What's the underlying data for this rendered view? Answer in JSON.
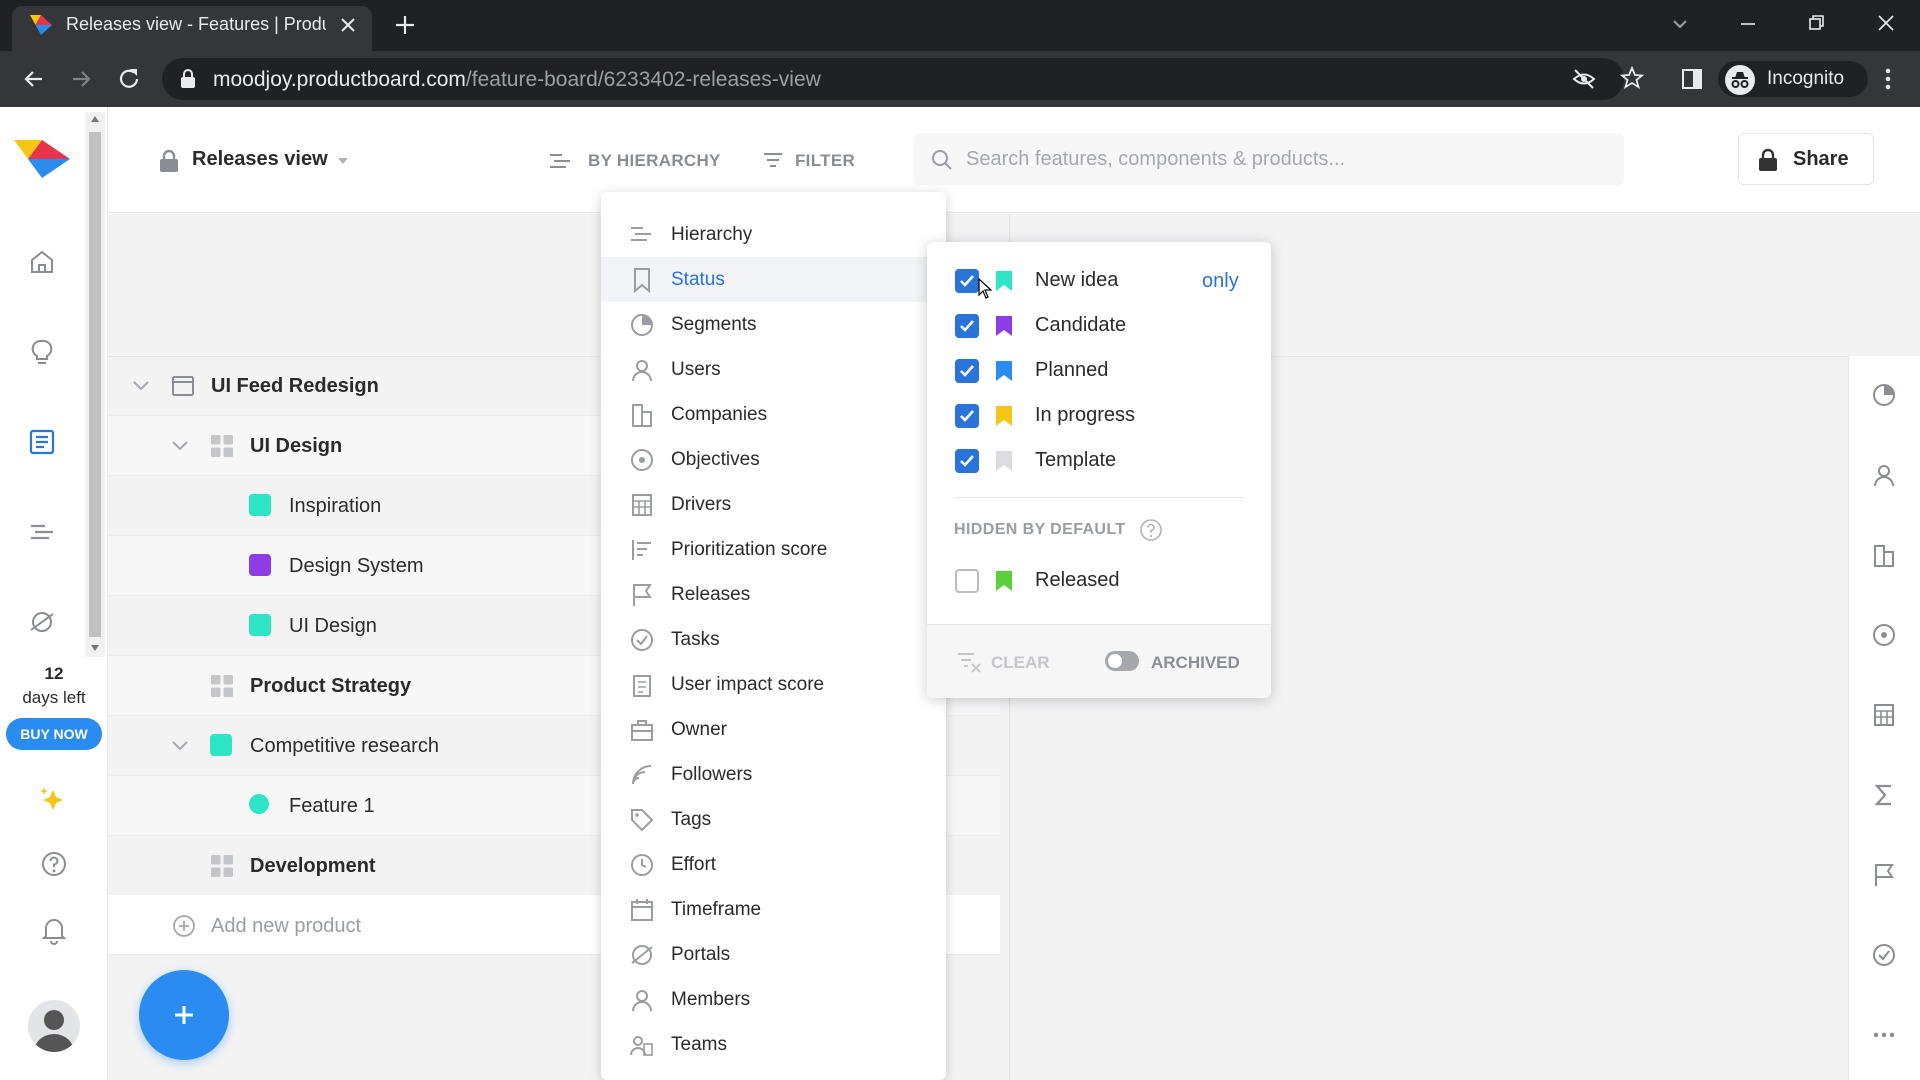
{
  "browser": {
    "tab_title": "Releases view - Features | Productboard",
    "url_host": "moodjoy.productboard.com",
    "url_path": "/feature-board/6233402-releases-view",
    "incognito_label": "Incognito"
  },
  "trial": {
    "days": "12",
    "days_label": "days left",
    "buy_label": "BUY NOW"
  },
  "topbar": {
    "view_name": "Releases view",
    "hierarchy_label": "BY HIERARCHY",
    "filter_label": "FILTER",
    "search_placeholder": "Search features, components & products...",
    "share_label": "Share"
  },
  "tree": [
    {
      "label": "UI Feed Redesign",
      "level": 0,
      "kind": "product",
      "bold": true,
      "chevron": true
    },
    {
      "label": "UI Design",
      "level": 1,
      "kind": "component",
      "bold": false,
      "chevron": true
    },
    {
      "label": "Inspiration",
      "level": 2,
      "kind": "square",
      "color": "#2ee6c6"
    },
    {
      "label": "Design System",
      "level": 2,
      "kind": "square",
      "color": "#8e3ce6"
    },
    {
      "label": "UI Design",
      "level": 2,
      "kind": "square",
      "color": "#2ee6c6"
    },
    {
      "label": "Product Strategy",
      "level": 1,
      "kind": "component",
      "bold": false,
      "chevron": false
    },
    {
      "label": "Competitive research",
      "level": 1,
      "kind": "square",
      "color": "#2ee6c6",
      "chevron": true
    },
    {
      "label": "Feature 1",
      "level": 2,
      "kind": "dot",
      "color": "#2ee6c6"
    },
    {
      "label": "Development",
      "level": 1,
      "kind": "component",
      "bold": false,
      "chevron": false
    }
  ],
  "add_product_label": "Add new product",
  "filter_menu": {
    "items": [
      {
        "label": "Hierarchy",
        "icon": "hierarchy-icon"
      },
      {
        "label": "Status",
        "icon": "bookmark-icon",
        "active": true
      },
      {
        "label": "Segments",
        "icon": "pie-icon"
      },
      {
        "label": "Users",
        "icon": "user-icon"
      },
      {
        "label": "Companies",
        "icon": "building-icon"
      },
      {
        "label": "Objectives",
        "icon": "target-icon"
      },
      {
        "label": "Drivers",
        "icon": "calculator-icon"
      },
      {
        "label": "Prioritization score",
        "icon": "score-icon"
      },
      {
        "label": "Releases",
        "icon": "flag-icon"
      },
      {
        "label": "Tasks",
        "icon": "check-circle-icon"
      },
      {
        "label": "User impact score",
        "icon": "clipboard-icon"
      },
      {
        "label": "Owner",
        "icon": "briefcase-icon"
      },
      {
        "label": "Followers",
        "icon": "rss-icon"
      },
      {
        "label": "Tags",
        "icon": "tag-icon"
      },
      {
        "label": "Effort",
        "icon": "clock-icon"
      },
      {
        "label": "Timeframe",
        "icon": "calendar-icon"
      },
      {
        "label": "Portals",
        "icon": "portal-icon"
      },
      {
        "label": "Members",
        "icon": "user-icon"
      },
      {
        "label": "Teams",
        "icon": "team-icon"
      }
    ]
  },
  "status_menu": {
    "only_label": "only",
    "statuses": [
      {
        "label": "New idea",
        "checked": true,
        "color": "#2ee6c6"
      },
      {
        "label": "Candidate",
        "checked": true,
        "color": "#8e3ce6"
      },
      {
        "label": "Planned",
        "checked": true,
        "color": "#2a8cf0"
      },
      {
        "label": "In progress",
        "checked": true,
        "color": "#f5c518"
      },
      {
        "label": "Template",
        "checked": true,
        "color": "#dcdde1"
      }
    ],
    "hidden_header": "HIDDEN BY DEFAULT",
    "hidden": [
      {
        "label": "Released",
        "checked": false,
        "color": "#5ad13c"
      }
    ],
    "clear_label": "CLEAR",
    "archived_label": "ARCHIVED"
  },
  "colors": {
    "accent": "#2a73d9",
    "fab": "#2a8cf0"
  }
}
